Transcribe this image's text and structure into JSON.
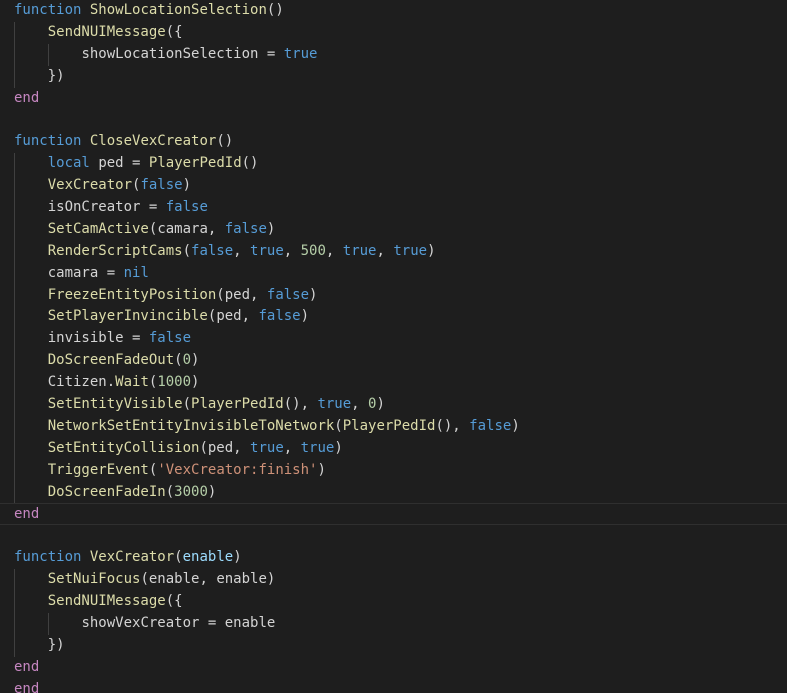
{
  "colors": {
    "background": "#1e1e1e",
    "kw": "#c586c0",
    "key": "#569cd6",
    "fn": "#dcdcaa",
    "id": "#d4d4d4",
    "param": "#9cdcfe",
    "num": "#b5cea8",
    "str": "#ce9178",
    "op": "#d4d4d4"
  },
  "lines": [
    {
      "indent": 0,
      "tokens": [
        [
          "key",
          "function"
        ],
        [
          "op",
          " "
        ],
        [
          "fn",
          "ShowLocationSelection"
        ],
        [
          "op",
          "()"
        ]
      ]
    },
    {
      "indent": 1,
      "tokens": [
        [
          "fn",
          "SendNUIMessage"
        ],
        [
          "op",
          "({"
        ]
      ]
    },
    {
      "indent": 2,
      "tokens": [
        [
          "id",
          "showLocationSelection"
        ],
        [
          "op",
          " = "
        ],
        [
          "key",
          "true"
        ]
      ]
    },
    {
      "indent": 1,
      "tokens": [
        [
          "op",
          "})"
        ]
      ]
    },
    {
      "indent": 0,
      "tokens": [
        [
          "kw",
          "end"
        ]
      ]
    },
    {
      "indent": 0,
      "tokens": []
    },
    {
      "indent": 0,
      "tokens": [
        [
          "key",
          "function"
        ],
        [
          "op",
          " "
        ],
        [
          "fn",
          "CloseVexCreator"
        ],
        [
          "op",
          "()"
        ]
      ]
    },
    {
      "indent": 1,
      "tokens": [
        [
          "key",
          "local"
        ],
        [
          "op",
          " "
        ],
        [
          "id",
          "ped"
        ],
        [
          "op",
          " = "
        ],
        [
          "fn",
          "PlayerPedId"
        ],
        [
          "op",
          "()"
        ]
      ]
    },
    {
      "indent": 1,
      "tokens": [
        [
          "fn",
          "VexCreator"
        ],
        [
          "op",
          "("
        ],
        [
          "key",
          "false"
        ],
        [
          "op",
          ")"
        ]
      ]
    },
    {
      "indent": 1,
      "tokens": [
        [
          "id",
          "isOnCreator"
        ],
        [
          "op",
          " = "
        ],
        [
          "key",
          "false"
        ]
      ]
    },
    {
      "indent": 1,
      "tokens": [
        [
          "fn",
          "SetCamActive"
        ],
        [
          "op",
          "("
        ],
        [
          "id",
          "camara"
        ],
        [
          "op",
          ", "
        ],
        [
          "key",
          "false"
        ],
        [
          "op",
          ")"
        ]
      ]
    },
    {
      "indent": 1,
      "tokens": [
        [
          "fn",
          "RenderScriptCams"
        ],
        [
          "op",
          "("
        ],
        [
          "key",
          "false"
        ],
        [
          "op",
          ", "
        ],
        [
          "key",
          "true"
        ],
        [
          "op",
          ", "
        ],
        [
          "num",
          "500"
        ],
        [
          "op",
          ", "
        ],
        [
          "key",
          "true"
        ],
        [
          "op",
          ", "
        ],
        [
          "key",
          "true"
        ],
        [
          "op",
          ")"
        ]
      ]
    },
    {
      "indent": 1,
      "tokens": [
        [
          "id",
          "camara"
        ],
        [
          "op",
          " = "
        ],
        [
          "key",
          "nil"
        ]
      ]
    },
    {
      "indent": 1,
      "tokens": [
        [
          "fn",
          "FreezeEntityPosition"
        ],
        [
          "op",
          "("
        ],
        [
          "id",
          "ped"
        ],
        [
          "op",
          ", "
        ],
        [
          "key",
          "false"
        ],
        [
          "op",
          ")"
        ]
      ]
    },
    {
      "indent": 1,
      "tokens": [
        [
          "fn",
          "SetPlayerInvincible"
        ],
        [
          "op",
          "("
        ],
        [
          "id",
          "ped"
        ],
        [
          "op",
          ", "
        ],
        [
          "key",
          "false"
        ],
        [
          "op",
          ")"
        ]
      ]
    },
    {
      "indent": 1,
      "tokens": [
        [
          "id",
          "invisible"
        ],
        [
          "op",
          " = "
        ],
        [
          "key",
          "false"
        ]
      ]
    },
    {
      "indent": 1,
      "tokens": [
        [
          "fn",
          "DoScreenFadeOut"
        ],
        [
          "op",
          "("
        ],
        [
          "num",
          "0"
        ],
        [
          "op",
          ")"
        ]
      ]
    },
    {
      "indent": 1,
      "tokens": [
        [
          "id",
          "Citizen"
        ],
        [
          "op",
          "."
        ],
        [
          "fn",
          "Wait"
        ],
        [
          "op",
          "("
        ],
        [
          "num",
          "1000"
        ],
        [
          "op",
          ")"
        ]
      ]
    },
    {
      "indent": 1,
      "tokens": [
        [
          "fn",
          "SetEntityVisible"
        ],
        [
          "op",
          "("
        ],
        [
          "fn",
          "PlayerPedId"
        ],
        [
          "op",
          "(), "
        ],
        [
          "key",
          "true"
        ],
        [
          "op",
          ", "
        ],
        [
          "num",
          "0"
        ],
        [
          "op",
          ")"
        ]
      ]
    },
    {
      "indent": 1,
      "tokens": [
        [
          "fn",
          "NetworkSetEntityInvisibleToNetwork"
        ],
        [
          "op",
          "("
        ],
        [
          "fn",
          "PlayerPedId"
        ],
        [
          "op",
          "(), "
        ],
        [
          "key",
          "false"
        ],
        [
          "op",
          ")"
        ]
      ]
    },
    {
      "indent": 1,
      "tokens": [
        [
          "fn",
          "SetEntityCollision"
        ],
        [
          "op",
          "("
        ],
        [
          "id",
          "ped"
        ],
        [
          "op",
          ", "
        ],
        [
          "key",
          "true"
        ],
        [
          "op",
          ", "
        ],
        [
          "key",
          "true"
        ],
        [
          "op",
          ")"
        ]
      ]
    },
    {
      "indent": 1,
      "tokens": [
        [
          "fn",
          "TriggerEvent"
        ],
        [
          "op",
          "("
        ],
        [
          "str",
          "'VexCreator:finish'"
        ],
        [
          "op",
          ")"
        ]
      ]
    },
    {
      "indent": 1,
      "tokens": [
        [
          "fn",
          "DoScreenFadeIn"
        ],
        [
          "op",
          "("
        ],
        [
          "num",
          "3000"
        ],
        [
          "op",
          ")"
        ]
      ]
    },
    {
      "indent": 0,
      "current": true,
      "tokens": [
        [
          "kw",
          "end"
        ]
      ]
    },
    {
      "indent": 0,
      "tokens": []
    },
    {
      "indent": 0,
      "tokens": [
        [
          "key",
          "function"
        ],
        [
          "op",
          " "
        ],
        [
          "fn",
          "VexCreator"
        ],
        [
          "op",
          "("
        ],
        [
          "param",
          "enable"
        ],
        [
          "op",
          ")"
        ]
      ]
    },
    {
      "indent": 1,
      "tokens": [
        [
          "fn",
          "SetNuiFocus"
        ],
        [
          "op",
          "("
        ],
        [
          "id",
          "enable"
        ],
        [
          "op",
          ", "
        ],
        [
          "id",
          "enable"
        ],
        [
          "op",
          ")"
        ]
      ]
    },
    {
      "indent": 1,
      "tokens": [
        [
          "fn",
          "SendNUIMessage"
        ],
        [
          "op",
          "({"
        ]
      ]
    },
    {
      "indent": 2,
      "tokens": [
        [
          "id",
          "showVexCreator"
        ],
        [
          "op",
          " = "
        ],
        [
          "id",
          "enable"
        ]
      ]
    },
    {
      "indent": 1,
      "tokens": [
        [
          "op",
          "})"
        ]
      ]
    },
    {
      "indent": 0,
      "tokens": [
        [
          "kw",
          "end"
        ]
      ]
    },
    {
      "indent": 0,
      "tokens": [
        [
          "kw",
          "end"
        ]
      ]
    }
  ]
}
